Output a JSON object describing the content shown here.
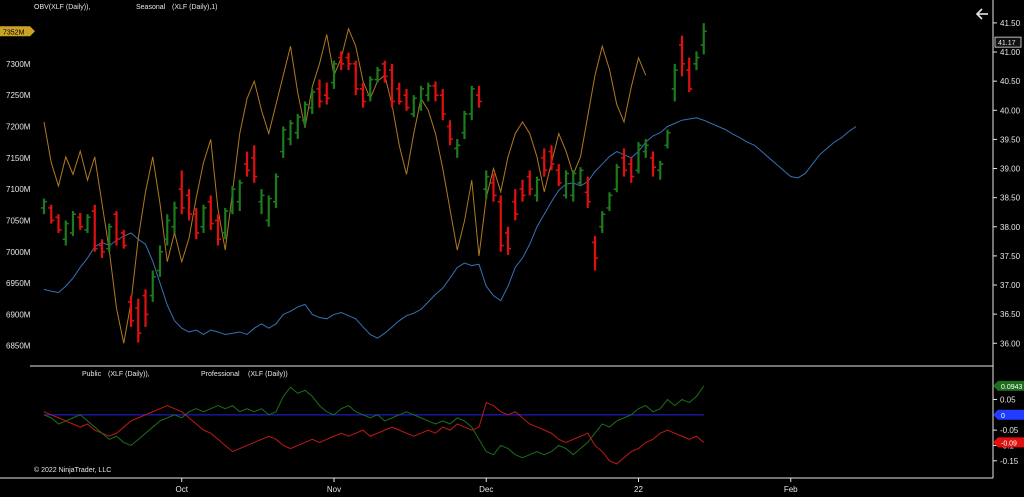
{
  "window": {
    "back_icon": "arrow-left-icon",
    "copyright": "© 2022 NinjaTrader, LLC"
  },
  "colors": {
    "background": "#000000",
    "up_bar": "#1e7a1e",
    "down_bar": "#e01010",
    "obv_line": "#3a6fb5",
    "seasonal_line": "#b07a20",
    "public_line": "#c01818",
    "professional_line": "#1c6e1c",
    "zero_line": "#1a1aaa",
    "axis_text": "#e6e6e6"
  },
  "chart_data": [
    {
      "type": "line",
      "panel": "price",
      "titles": {
        "obv": "OBV(XLF (Daily)),",
        "seasonal": "Seasonal",
        "seasonal_params": "(XLF (Daily),1)"
      },
      "x_ticks": [
        "Oct",
        "Nov",
        "Dec",
        "22",
        "Feb"
      ],
      "x_tick_index": [
        19,
        40,
        61,
        82,
        103
      ],
      "x_count": 126,
      "y_left_ticks": [
        "7300M",
        "7250M",
        "7200M",
        "7150M",
        "7100M",
        "7050M",
        "7000M",
        "6950M",
        "6900M",
        "6850M"
      ],
      "y_left_badge": "7352M",
      "y_left_range": [
        6840,
        7370
      ],
      "y_right_ticks": [
        "41.50",
        "41.00",
        "40.50",
        "40.00",
        "39.50",
        "39.00",
        "38.50",
        "38.00",
        "37.50",
        "37.00",
        "36.50",
        "36.00"
      ],
      "y_right_badge": "41.17",
      "y_right_range": [
        35.85,
        41.55
      ],
      "obv": [
        6940,
        6937,
        6935,
        6945,
        6958,
        6975,
        6990,
        7008,
        7015,
        7010,
        7018,
        7025,
        7030,
        7020,
        7012,
        6985,
        6950,
        6915,
        6890,
        6878,
        6872,
        6875,
        6868,
        6875,
        6872,
        6868,
        6870,
        6872,
        6868,
        6878,
        6885,
        6878,
        6885,
        6900,
        6905,
        6912,
        6916,
        6900,
        6895,
        6893,
        6900,
        6903,
        6898,
        6893,
        6880,
        6868,
        6862,
        6870,
        6880,
        6890,
        6898,
        6902,
        6908,
        6920,
        6932,
        6942,
        6958,
        6975,
        6982,
        6978,
        6980,
        6945,
        6930,
        6922,
        6945,
        6975,
        6990,
        7012,
        7040,
        7060,
        7080,
        7098,
        7108,
        7110,
        7105,
        7112,
        7128,
        7140,
        7152,
        7160,
        7155,
        7150,
        7160,
        7175,
        7185,
        7190,
        7200,
        7205,
        7210,
        7212,
        7214,
        7210,
        7205,
        7200,
        7195,
        7188,
        7182,
        7175,
        7170,
        7160,
        7150,
        7140,
        7130,
        7120,
        7118,
        7125,
        7140,
        7155,
        7165,
        7175,
        7182,
        7192,
        7200
      ],
      "seasonal_price": [
        39.8,
        39.1,
        38.7,
        39.2,
        38.9,
        39.3,
        38.8,
        39.2,
        38.4,
        37.6,
        36.6,
        36.0,
        36.7,
        37.8,
        38.6,
        39.2,
        38.4,
        37.4,
        37.9,
        37.4,
        37.8,
        38.5,
        39.1,
        39.5,
        38.3,
        37.6,
        38.6,
        39.6,
        40.2,
        40.5,
        40.0,
        39.6,
        40.1,
        40.6,
        41.1,
        40.3,
        39.7,
        40.4,
        40.8,
        41.3,
        40.6,
        40.9,
        41.4,
        41.1,
        40.5,
        40.2,
        40.5,
        40.6,
        40.1,
        39.4,
        38.9,
        39.6,
        40.2,
        40.0,
        39.6,
        39.0,
        38.3,
        37.6,
        38.1,
        38.8,
        37.5,
        38.5,
        39.0,
        38.6,
        39.2,
        39.6,
        39.8,
        39.6,
        39.2,
        38.6,
        39.1,
        39.6,
        39.3,
        38.9,
        39.2,
        39.9,
        40.6,
        41.1,
        40.7,
        40.1,
        39.8,
        40.4,
        40.9,
        40.6
      ]
    },
    {
      "type": "ohlc",
      "panel": "price",
      "unit": "OBV millions",
      "bars": [
        {
          "i": 0,
          "o": 7070,
          "h": 7085,
          "l": 7060,
          "c": 7080
        },
        {
          "i": 1,
          "o": 7070,
          "h": 7075,
          "l": 7045,
          "c": 7050
        },
        {
          "i": 2,
          "o": 7055,
          "h": 7060,
          "l": 7030,
          "c": 7035
        },
        {
          "i": 3,
          "o": 7020,
          "h": 7050,
          "l": 7010,
          "c": 7045
        },
        {
          "i": 4,
          "o": 7030,
          "h": 7065,
          "l": 7025,
          "c": 7060
        },
        {
          "i": 5,
          "o": 7055,
          "h": 7062,
          "l": 7035,
          "c": 7040
        },
        {
          "i": 6,
          "o": 7035,
          "h": 7060,
          "l": 7030,
          "c": 7055
        },
        {
          "i": 7,
          "o": 7065,
          "h": 7075,
          "l": 7000,
          "c": 7005
        },
        {
          "i": 8,
          "o": 7010,
          "h": 7020,
          "l": 6990,
          "c": 7000
        },
        {
          "i": 9,
          "o": 7005,
          "h": 7045,
          "l": 7000,
          "c": 7040
        },
        {
          "i": 10,
          "o": 7060,
          "h": 7065,
          "l": 7010,
          "c": 7020
        },
        {
          "i": 11,
          "o": 7030,
          "h": 7035,
          "l": 7005,
          "c": 7010
        },
        {
          "i": 12,
          "o": 6920,
          "h": 6930,
          "l": 6880,
          "c": 6890
        },
        {
          "i": 13,
          "o": 6910,
          "h": 6925,
          "l": 6855,
          "c": 6870
        },
        {
          "i": 14,
          "o": 6930,
          "h": 6940,
          "l": 6880,
          "c": 6900
        },
        {
          "i": 15,
          "o": 6930,
          "h": 6970,
          "l": 6920,
          "c": 6960
        },
        {
          "i": 16,
          "o": 6970,
          "h": 7010,
          "l": 6960,
          "c": 7000
        },
        {
          "i": 17,
          "o": 7020,
          "h": 7060,
          "l": 7010,
          "c": 7050
        },
        {
          "i": 18,
          "o": 7040,
          "h": 7080,
          "l": 7030,
          "c": 7070
        },
        {
          "i": 19,
          "o": 7100,
          "h": 7130,
          "l": 7060,
          "c": 7070
        },
        {
          "i": 20,
          "o": 7090,
          "h": 7100,
          "l": 7050,
          "c": 7060
        },
        {
          "i": 21,
          "o": 7060,
          "h": 7070,
          "l": 7020,
          "c": 7030
        },
        {
          "i": 22,
          "o": 7040,
          "h": 7075,
          "l": 7030,
          "c": 7070
        },
        {
          "i": 23,
          "o": 7080,
          "h": 7090,
          "l": 7035,
          "c": 7045
        },
        {
          "i": 24,
          "o": 7050,
          "h": 7060,
          "l": 7010,
          "c": 7020
        },
        {
          "i": 25,
          "o": 7030,
          "h": 7070,
          "l": 7020,
          "c": 7065
        },
        {
          "i": 26,
          "o": 7065,
          "h": 7105,
          "l": 7060,
          "c": 7100
        },
        {
          "i": 27,
          "o": 7080,
          "h": 7115,
          "l": 7065,
          "c": 7110
        },
        {
          "i": 28,
          "o": 7140,
          "h": 7160,
          "l": 7120,
          "c": 7130
        },
        {
          "i": 29,
          "o": 7150,
          "h": 7170,
          "l": 7110,
          "c": 7120
        },
        {
          "i": 30,
          "o": 7080,
          "h": 7100,
          "l": 7060,
          "c": 7090
        },
        {
          "i": 31,
          "o": 7050,
          "h": 7090,
          "l": 7040,
          "c": 7085
        },
        {
          "i": 32,
          "o": 7080,
          "h": 7125,
          "l": 7070,
          "c": 7120
        },
        {
          "i": 33,
          "o": 7160,
          "h": 7200,
          "l": 7150,
          "c": 7195
        },
        {
          "i": 34,
          "o": 7180,
          "h": 7210,
          "l": 7170,
          "c": 7205
        },
        {
          "i": 35,
          "o": 7190,
          "h": 7220,
          "l": 7180,
          "c": 7215
        },
        {
          "i": 36,
          "o": 7210,
          "h": 7240,
          "l": 7200,
          "c": 7235
        },
        {
          "i": 37,
          "o": 7230,
          "h": 7260,
          "l": 7220,
          "c": 7255
        },
        {
          "i": 38,
          "o": 7260,
          "h": 7275,
          "l": 7230,
          "c": 7240
        },
        {
          "i": 39,
          "o": 7250,
          "h": 7270,
          "l": 7235,
          "c": 7245
        },
        {
          "i": 40,
          "o": 7270,
          "h": 7305,
          "l": 7260,
          "c": 7300
        },
        {
          "i": 41,
          "o": 7310,
          "h": 7320,
          "l": 7290,
          "c": 7300
        },
        {
          "i": 42,
          "o": 7310,
          "h": 7318,
          "l": 7290,
          "c": 7300
        },
        {
          "i": 43,
          "o": 7300,
          "h": 7305,
          "l": 7250,
          "c": 7260
        },
        {
          "i": 44,
          "o": 7260,
          "h": 7270,
          "l": 7230,
          "c": 7240
        },
        {
          "i": 45,
          "o": 7250,
          "h": 7280,
          "l": 7240,
          "c": 7275
        },
        {
          "i": 46,
          "o": 7275,
          "h": 7295,
          "l": 7270,
          "c": 7290
        },
        {
          "i": 47,
          "o": 7300,
          "h": 7305,
          "l": 7270,
          "c": 7280
        },
        {
          "i": 48,
          "o": 7290,
          "h": 7300,
          "l": 7230,
          "c": 7240
        },
        {
          "i": 49,
          "o": 7260,
          "h": 7270,
          "l": 7235,
          "c": 7240
        },
        {
          "i": 50,
          "o": 7250,
          "h": 7260,
          "l": 7225,
          "c": 7230
        },
        {
          "i": 51,
          "o": 7220,
          "h": 7250,
          "l": 7215,
          "c": 7245
        },
        {
          "i": 52,
          "o": 7230,
          "h": 7265,
          "l": 7225,
          "c": 7260
        },
        {
          "i": 53,
          "o": 7250,
          "h": 7270,
          "l": 7240,
          "c": 7265
        },
        {
          "i": 54,
          "o": 7265,
          "h": 7272,
          "l": 7240,
          "c": 7250
        },
        {
          "i": 55,
          "o": 7250,
          "h": 7260,
          "l": 7210,
          "c": 7220
        },
        {
          "i": 56,
          "o": 7200,
          "h": 7210,
          "l": 7170,
          "c": 7180
        },
        {
          "i": 57,
          "o": 7165,
          "h": 7180,
          "l": 7150,
          "c": 7170
        },
        {
          "i": 58,
          "o": 7190,
          "h": 7225,
          "l": 7180,
          "c": 7220
        },
        {
          "i": 59,
          "o": 7220,
          "h": 7265,
          "l": 7210,
          "c": 7260
        },
        {
          "i": 60,
          "o": 7250,
          "h": 7265,
          "l": 7230,
          "c": 7240
        },
        {
          "i": 61,
          "o": 7100,
          "h": 7130,
          "l": 7085,
          "c": 7120
        },
        {
          "i": 62,
          "o": 7110,
          "h": 7125,
          "l": 7080,
          "c": 7090
        },
        {
          "i": 63,
          "o": 7080,
          "h": 7090,
          "l": 7000,
          "c": 7010
        },
        {
          "i": 64,
          "o": 7030,
          "h": 7040,
          "l": 6995,
          "c": 7005
        },
        {
          "i": 65,
          "o": 7080,
          "h": 7100,
          "l": 7050,
          "c": 7060
        },
        {
          "i": 66,
          "o": 7100,
          "h": 7115,
          "l": 7080,
          "c": 7090
        },
        {
          "i": 67,
          "o": 7120,
          "h": 7130,
          "l": 7090,
          "c": 7100
        },
        {
          "i": 68,
          "o": 7090,
          "h": 7120,
          "l": 7080,
          "c": 7115
        },
        {
          "i": 69,
          "o": 7150,
          "h": 7165,
          "l": 7120,
          "c": 7130
        },
        {
          "i": 70,
          "o": 7160,
          "h": 7170,
          "l": 7130,
          "c": 7140
        },
        {
          "i": 71,
          "o": 7130,
          "h": 7140,
          "l": 7105,
          "c": 7110
        },
        {
          "i": 72,
          "o": 7090,
          "h": 7130,
          "l": 7085,
          "c": 7125
        },
        {
          "i": 73,
          "o": 7090,
          "h": 7130,
          "l": 7080,
          "c": 7125
        },
        {
          "i": 74,
          "o": 7110,
          "h": 7135,
          "l": 7105,
          "c": 7130
        },
        {
          "i": 75,
          "o": 7095,
          "h": 7120,
          "l": 7070,
          "c": 7080
        },
        {
          "i": 76,
          "o": 7015,
          "h": 7025,
          "l": 6970,
          "c": 6990
        },
        {
          "i": 77,
          "o": 7040,
          "h": 7065,
          "l": 7030,
          "c": 7060
        },
        {
          "i": 78,
          "o": 7070,
          "h": 7095,
          "l": 7065,
          "c": 7090
        },
        {
          "i": 79,
          "o": 7100,
          "h": 7140,
          "l": 7095,
          "c": 7135
        },
        {
          "i": 80,
          "o": 7150,
          "h": 7165,
          "l": 7120,
          "c": 7130
        },
        {
          "i": 81,
          "o": 7140,
          "h": 7150,
          "l": 7110,
          "c": 7120
        },
        {
          "i": 82,
          "o": 7130,
          "h": 7175,
          "l": 7125,
          "c": 7170
        },
        {
          "i": 83,
          "o": 7160,
          "h": 7180,
          "l": 7150,
          "c": 7170
        },
        {
          "i": 84,
          "o": 7150,
          "h": 7160,
          "l": 7120,
          "c": 7135
        },
        {
          "i": 85,
          "o": 7130,
          "h": 7145,
          "l": 7115,
          "c": 7140
        },
        {
          "i": 86,
          "o": 7170,
          "h": 7195,
          "l": 7165,
          "c": 7190
        },
        {
          "i": 87,
          "o": 7260,
          "h": 7300,
          "l": 7240,
          "c": 7290
        },
        {
          "i": 88,
          "o": 7330,
          "h": 7345,
          "l": 7280,
          "c": 7300
        },
        {
          "i": 89,
          "o": 7290,
          "h": 7310,
          "l": 7255,
          "c": 7260
        },
        {
          "i": 90,
          "o": 7300,
          "h": 7320,
          "l": 7290,
          "c": 7310
        },
        {
          "i": 91,
          "o": 7330,
          "h": 7365,
          "l": 7315,
          "c": 7352
        }
      ]
    },
    {
      "type": "line",
      "panel": "oscillator",
      "titles": {
        "public": "Public",
        "public_params": "(XLF (Daily)),",
        "professional": "Professional",
        "professional_params": "(XLF (Daily))"
      },
      "y_ticks": [
        "0.05",
        "-0.05",
        "-0.1",
        "-0.15"
      ],
      "y_range": [
        -0.18,
        0.12
      ],
      "badges": {
        "professional": "0.0943",
        "zero": "0",
        "public": "-0.09"
      },
      "zero_line": 0,
      "public": [
        0.01,
        0.0,
        -0.01,
        -0.02,
        -0.03,
        -0.04,
        -0.03,
        -0.05,
        -0.06,
        -0.07,
        -0.06,
        -0.04,
        -0.02,
        -0.01,
        0.0,
        0.01,
        0.02,
        0.03,
        0.02,
        0.01,
        -0.01,
        -0.03,
        -0.05,
        -0.06,
        -0.08,
        -0.1,
        -0.12,
        -0.11,
        -0.1,
        -0.09,
        -0.08,
        -0.07,
        -0.08,
        -0.1,
        -0.11,
        -0.1,
        -0.09,
        -0.08,
        -0.09,
        -0.08,
        -0.07,
        -0.06,
        -0.07,
        -0.06,
        -0.05,
        -0.07,
        -0.06,
        -0.05,
        -0.04,
        -0.05,
        -0.06,
        -0.07,
        -0.06,
        -0.05,
        -0.06,
        -0.04,
        -0.05,
        -0.03,
        -0.04,
        -0.05,
        -0.04,
        0.04,
        0.03,
        0.01,
        0.0,
        0.01,
        -0.01,
        -0.03,
        -0.04,
        -0.05,
        -0.06,
        -0.08,
        -0.09,
        -0.08,
        -0.07,
        -0.06,
        -0.1,
        -0.12,
        -0.15,
        -0.16,
        -0.14,
        -0.12,
        -0.11,
        -0.09,
        -0.08,
        -0.06,
        -0.05,
        -0.06,
        -0.07,
        -0.08,
        -0.07,
        -0.09
      ],
      "professional": [
        0.0,
        -0.01,
        -0.03,
        -0.02,
        -0.01,
        0.0,
        -0.02,
        -0.04,
        -0.06,
        -0.08,
        -0.07,
        -0.09,
        -0.1,
        -0.08,
        -0.06,
        -0.04,
        -0.02,
        -0.01,
        0.0,
        -0.01,
        0.01,
        0.02,
        0.01,
        0.02,
        0.03,
        0.02,
        0.03,
        0.01,
        0.02,
        0.01,
        0.02,
        0.0,
        0.01,
        0.06,
        0.09,
        0.07,
        0.08,
        0.06,
        0.03,
        0.01,
        0.0,
        0.02,
        0.03,
        0.01,
        0.0,
        -0.01,
        0.0,
        -0.02,
        -0.01,
        0.0,
        0.01,
        0.0,
        -0.01,
        -0.02,
        -0.03,
        -0.02,
        -0.03,
        -0.01,
        -0.02,
        -0.04,
        -0.08,
        -0.12,
        -0.13,
        -0.1,
        -0.11,
        -0.13,
        -0.14,
        -0.13,
        -0.12,
        -0.13,
        -0.12,
        -0.1,
        -0.11,
        -0.13,
        -0.11,
        -0.09,
        -0.06,
        -0.03,
        -0.04,
        -0.02,
        -0.01,
        0.0,
        0.02,
        0.03,
        0.01,
        0.02,
        0.05,
        0.03,
        0.05,
        0.04,
        0.06,
        0.094
      ]
    }
  ]
}
